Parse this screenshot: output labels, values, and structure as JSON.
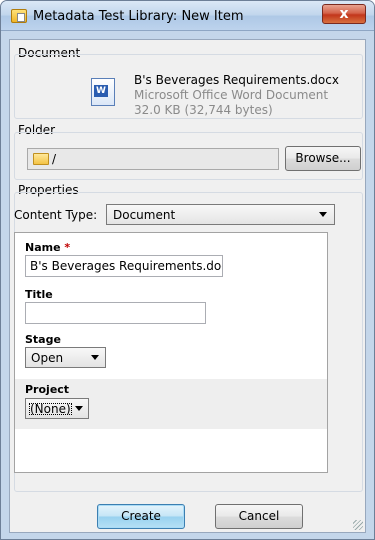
{
  "window": {
    "title": "Metadata Test Library: New Item",
    "close_label": "x"
  },
  "document_group": {
    "label": "Document",
    "file_name": "B's Beverages Requirements.docx",
    "file_type": "Microsoft Office Word Document",
    "file_size": "32.0 KB (32,744 bytes)",
    "icon": "word-document-icon"
  },
  "folder_group": {
    "label": "Folder",
    "path": "/",
    "browse_label": "Browse...",
    "icon": "folder-icon"
  },
  "properties_group": {
    "label": "Properties",
    "content_type_label": "Content Type:",
    "content_type_value": "Document",
    "fields": {
      "name_label": "Name",
      "name_required_marker": "*",
      "name_value": "B's Beverages Requirements.docx",
      "title_label": "Title",
      "title_value": "",
      "stage_label": "Stage",
      "stage_value": "Open",
      "project_label": "Project",
      "project_value": "(None)"
    }
  },
  "buttons": {
    "create_label": "Create",
    "cancel_label": "Cancel"
  },
  "colors": {
    "required_marker": "#c00000",
    "create_button": "#98d1ef",
    "close_button": "#c2361b"
  }
}
